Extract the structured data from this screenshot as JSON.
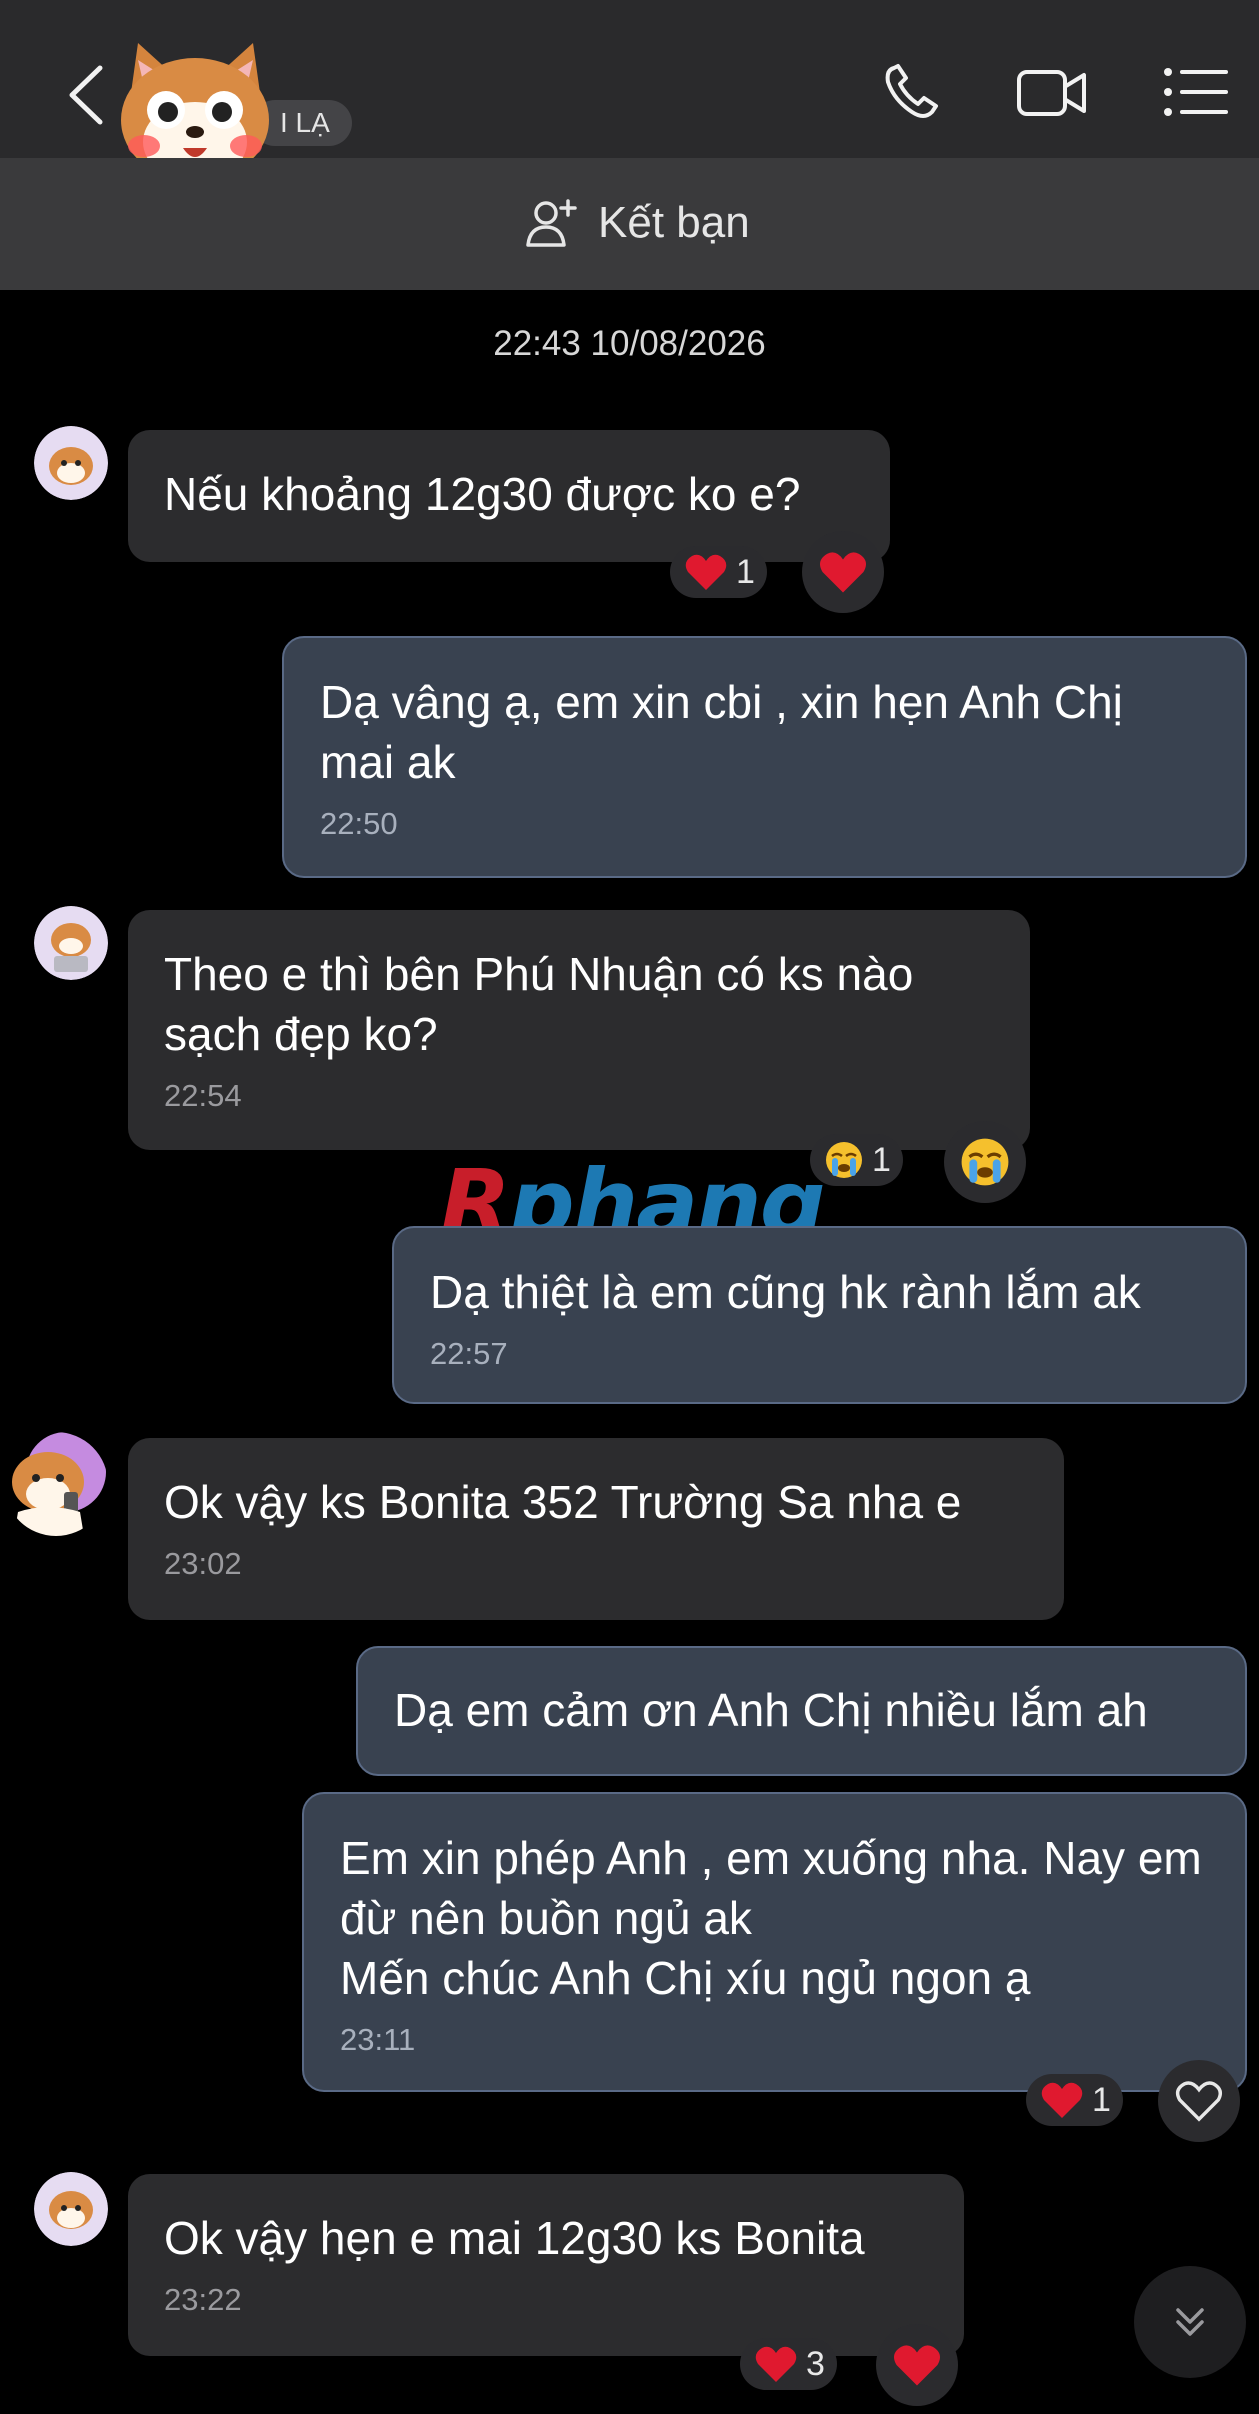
{
  "header": {
    "stranger_badge": "I LẠ",
    "add_friend_label": "Kết bạn"
  },
  "date_separator": "22:43 10/08/2026",
  "messages": [
    {
      "text": "Nếu khoảng 12g30 được ko e?",
      "time": "",
      "reaction_count": "1",
      "reaction_icon": "heart"
    },
    {
      "text": "Dạ vâng ạ, em xin cbi , xin hẹn Anh Chị mai ak",
      "time": "22:50"
    },
    {
      "text": "Theo e thì bên Phú Nhuận có ks nào sạch đẹp ko?",
      "time": "22:54",
      "reaction_count": "1",
      "reaction_icon": "crying-face"
    },
    {
      "text": "Dạ thiệt là em cũng hk rành lắm ak",
      "time": "22:57"
    },
    {
      "text": "Ok vậy ks Bonita 352 Trường Sa nha e",
      "time": "23:02"
    },
    {
      "text": "Dạ em cảm ơn Anh Chị nhiều lắm ah",
      "time": ""
    },
    {
      "line1": "Em xin phép Anh , em xuống nha. Nay em đừ nên buồn ngủ ak",
      "line2": "Mến chúc Anh Chị xíu ngủ ngon ạ",
      "time": "23:11",
      "reaction_count": "1",
      "reaction_icon": "heart"
    },
    {
      "text": "Ok vậy hẹn e mai 12g30 ks Bonita",
      "time": "23:22",
      "reaction_count": "3",
      "reaction_icon": "heart"
    }
  ],
  "watermark": {
    "first": "R",
    "rest": "phang"
  },
  "colors": {
    "incoming_bubble": "#2c2c2e",
    "outgoing_bubble": "#394250",
    "heart": "#e0192f"
  }
}
